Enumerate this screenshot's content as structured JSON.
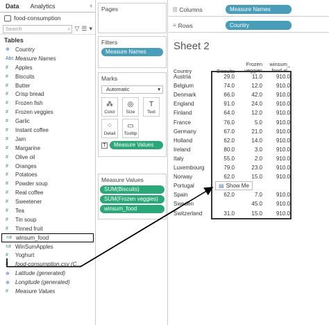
{
  "datapane": {
    "tabs": [
      "Data",
      "Analytics"
    ],
    "collapse_glyph": "‹",
    "source": "food-consumption",
    "search_placeholder": "Search",
    "tables_header": "Tables",
    "fields": [
      {
        "type": "globe",
        "name": "Country"
      },
      {
        "type": "Abc",
        "name": "Measure Names",
        "italic": true
      },
      {
        "type": "#",
        "name": "Apples"
      },
      {
        "type": "#",
        "name": "Biscuits"
      },
      {
        "type": "#",
        "name": "Butter"
      },
      {
        "type": "#",
        "name": "Crisp bread"
      },
      {
        "type": "#",
        "name": "Frozen fish"
      },
      {
        "type": "#",
        "name": "Frozen veggies"
      },
      {
        "type": "#",
        "name": "Garlic"
      },
      {
        "type": "#",
        "name": "Instant coffee"
      },
      {
        "type": "#",
        "name": "Jam"
      },
      {
        "type": "#",
        "name": "Margarine"
      },
      {
        "type": "#",
        "name": "Olive oil"
      },
      {
        "type": "#",
        "name": "Oranges"
      },
      {
        "type": "#",
        "name": "Potatoes"
      },
      {
        "type": "#",
        "name": "Powder soup"
      },
      {
        "type": "#",
        "name": "Real coffee"
      },
      {
        "type": "#",
        "name": "Sweetener"
      },
      {
        "type": "#",
        "name": "Tea"
      },
      {
        "type": "#",
        "name": "Tin soup"
      },
      {
        "type": "#",
        "name": "Tinned fruit"
      },
      {
        "type": "=#",
        "name": "winsum_food",
        "selected": true
      },
      {
        "type": "=#",
        "name": "WinSumApples"
      },
      {
        "type": "#",
        "name": "Yoghurt"
      },
      {
        "type": "#",
        "name": "food-consumption.csv (C...",
        "italic": true
      },
      {
        "type": "globe",
        "name": "Latitude (generated)",
        "italic": true
      },
      {
        "type": "globe",
        "name": "Longitude (generated)",
        "italic": true
      },
      {
        "type": "#",
        "name": "Measure Values",
        "italic": true
      }
    ]
  },
  "cards": {
    "pages_title": "Pages",
    "filters_title": "Filters",
    "filter_pill": "Measure Names",
    "marks_title": "Marks",
    "mark_type": "Automatic",
    "mark_buttons": [
      {
        "label": "Color",
        "icon": "color-icon"
      },
      {
        "label": "Size",
        "icon": "size-icon"
      },
      {
        "label": "Text",
        "icon": "text-icon"
      },
      {
        "label": "Detail",
        "icon": "detail-icon"
      },
      {
        "label": "Tooltip",
        "icon": "tooltip-icon"
      }
    ],
    "marks_pill": "Measure Values",
    "measure_values_title": "Measure Values",
    "measure_pills": [
      "SUM(Biscuits)",
      "SUM(Frozen veggies)",
      "winsum_food"
    ]
  },
  "shelves": {
    "columns_label": "Columns",
    "columns_pill": "Measure Names",
    "rows_label": "Rows",
    "rows_pill": "Country"
  },
  "sheet": {
    "title": "Sheet 2",
    "row_header": "Country",
    "col_headers": [
      "Biscuits",
      "Frozen\nveggies",
      "winsum_\nfood al.."
    ],
    "rows": [
      {
        "country": "Austria",
        "v": [
          "29.0",
          "11.0",
          "910.0"
        ]
      },
      {
        "country": "Belgium",
        "v": [
          "74.0",
          "12.0",
          "910.0"
        ]
      },
      {
        "country": "Denmark",
        "v": [
          "66.0",
          "42.0",
          "910.0"
        ]
      },
      {
        "country": "England",
        "v": [
          "91.0",
          "24.0",
          "910.0"
        ]
      },
      {
        "country": "Finland",
        "v": [
          "64.0",
          "12.0",
          "910.0"
        ]
      },
      {
        "country": "France",
        "v": [
          "76.0",
          "5.0",
          "910.0"
        ]
      },
      {
        "country": "Germany",
        "v": [
          "67.0",
          "21.0",
          "910.0"
        ]
      },
      {
        "country": "Holland",
        "v": [
          "62.0",
          "14.0",
          "910.0"
        ]
      },
      {
        "country": "Ireland",
        "v": [
          "80.0",
          "3.0",
          "910.0"
        ]
      },
      {
        "country": "Italy",
        "v": [
          "55.0",
          "2.0",
          "910.0"
        ]
      },
      {
        "country": "Luxembourg",
        "v": [
          "79.0",
          "23.0",
          "910.0"
        ]
      },
      {
        "country": "Norway",
        "v": [
          "62.0",
          "15.0",
          "910.0"
        ]
      },
      {
        "country": "Portugal",
        "v": [
          "",
          "",
          ""
        ]
      },
      {
        "country": "Spain",
        "v": [
          "62.0",
          "7.0",
          "910.0"
        ]
      },
      {
        "country": "Sweden",
        "v": [
          "",
          "45.0",
          "910.0"
        ]
      },
      {
        "country": "Switzerland",
        "v": [
          "31.0",
          "15.0",
          "910.0"
        ]
      }
    ],
    "show_me": "Show Me"
  }
}
